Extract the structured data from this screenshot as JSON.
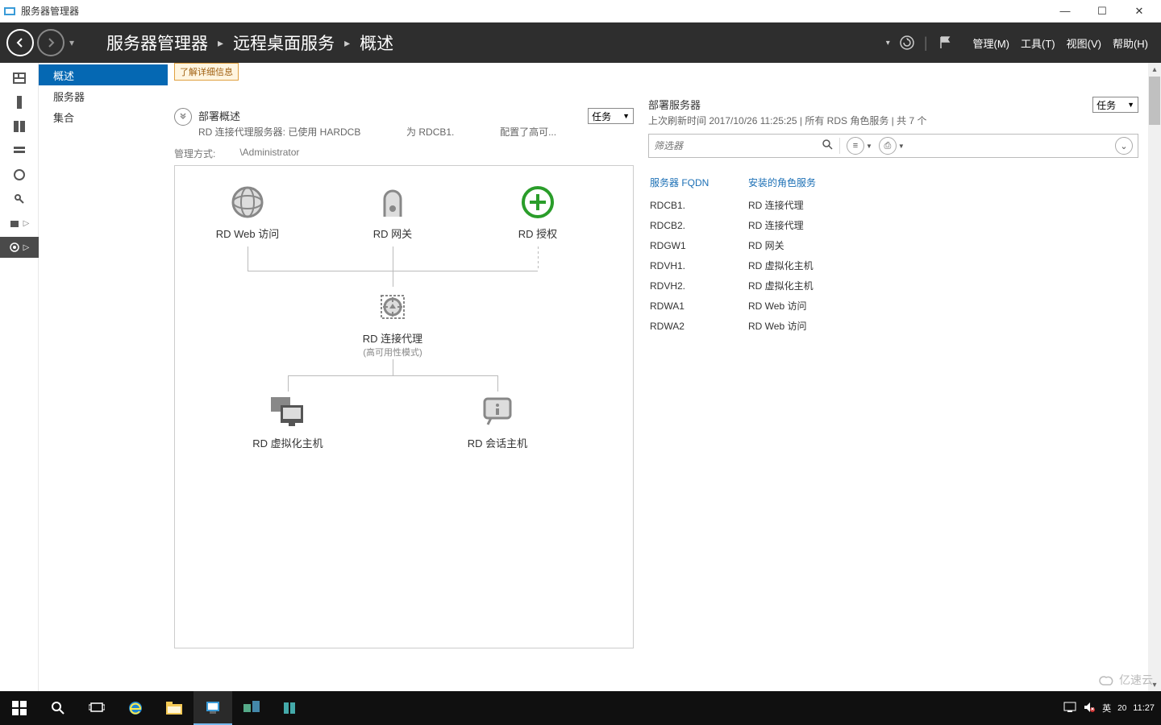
{
  "window": {
    "title": "服务器管理器",
    "controls": {
      "min": "—",
      "max": "☐",
      "close": "✕"
    }
  },
  "header": {
    "breadcrumbs": [
      "服务器管理器",
      "远程桌面服务",
      "概述"
    ],
    "menus": {
      "manage": "管理(M)",
      "tools": "工具(T)",
      "view": "视图(V)",
      "help": "帮助(H)"
    }
  },
  "nav": {
    "items": [
      "概述",
      "服务器",
      "集合"
    ],
    "selected": 0
  },
  "notice_banner": "了解详细信息",
  "deployment_overview": {
    "title": "部署概述",
    "subtitle_left": "RD 连接代理服务器: 已使用 HARDCB",
    "subtitle_mid": "为 RDCB1.",
    "subtitle_right": "配置了高可...",
    "tasks": "任务",
    "manage_label": "管理方式:",
    "manage_value": "\\Administrator",
    "nodes": {
      "rd_web": "RD Web 访问",
      "rd_gateway": "RD 网关",
      "rd_license": "RD 授权",
      "rd_broker": "RD 连接代理",
      "rd_broker_sub": "(高可用性模式)",
      "rd_virt_host": "RD 虚拟化主机",
      "rd_session_host": "RD 会话主机"
    }
  },
  "deployment_servers": {
    "title": "部署服务器",
    "meta": "上次刷新时间 2017/10/26 11:25:25 | 所有 RDS 角色服务  | 共 7 个",
    "tasks": "任务",
    "filter_placeholder": "筛选器",
    "columns": {
      "fqdn": "服务器 FQDN",
      "role": "安装的角色服务"
    },
    "rows": [
      {
        "fqdn": "RDCB1.",
        "role": "RD 连接代理"
      },
      {
        "fqdn": "RDCB2.",
        "role": "RD 连接代理"
      },
      {
        "fqdn": "RDGW1",
        "role": "RD 网关"
      },
      {
        "fqdn": "RDVH1.",
        "role": "RD 虚拟化主机"
      },
      {
        "fqdn": "RDVH2.",
        "role": "RD 虚拟化主机"
      },
      {
        "fqdn": "RDWA1",
        "role": "RD Web 访问"
      },
      {
        "fqdn": "RDWA2",
        "role": "RD Web 访问"
      }
    ]
  },
  "taskbar": {
    "ime": "英",
    "ime_num": "20",
    "clock_time": "11:27"
  },
  "watermark": "亿速云"
}
